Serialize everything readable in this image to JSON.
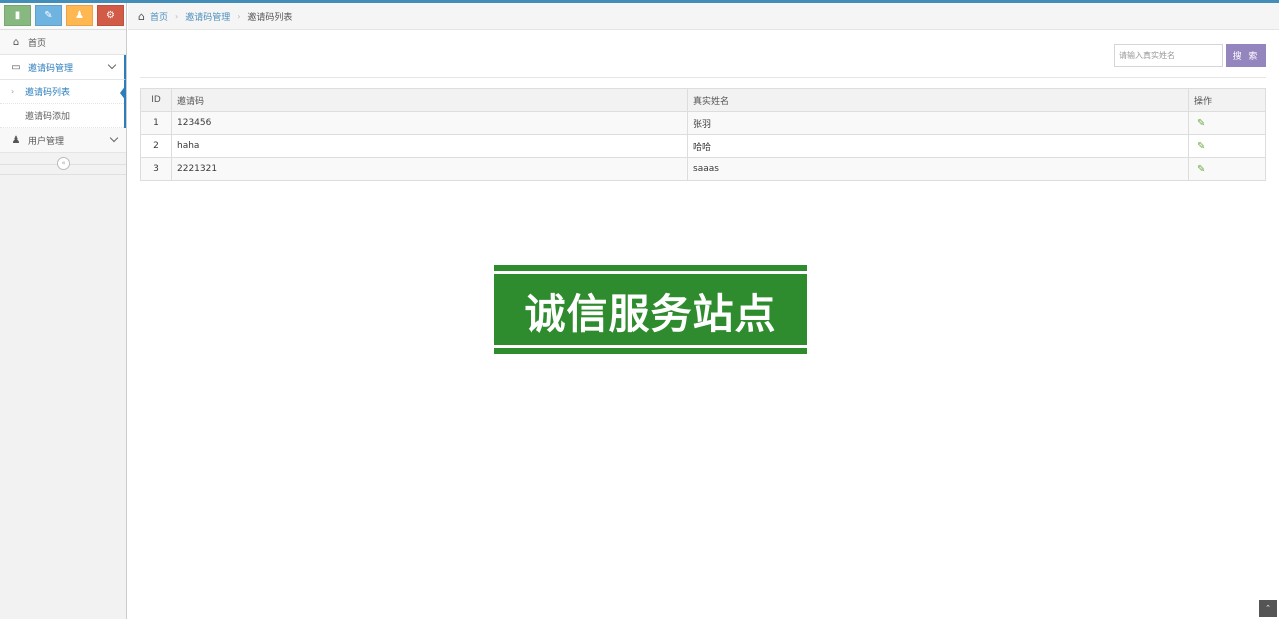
{
  "colors": {
    "accent": "#438eb9",
    "shortcut_1": "#87b87f",
    "shortcut_2": "#6fb3e0",
    "shortcut_3": "#ffb752",
    "shortcut_4": "#d15b47",
    "search_button": "#9585bf",
    "stamp": "#2e8b2e"
  },
  "shortcuts": [
    "signal-icon",
    "pencil-icon",
    "users-icon",
    "cogs-icon"
  ],
  "sidebar": {
    "home": "首页",
    "invite_mgmt": "邀请码管理",
    "invite_list": "邀请码列表",
    "invite_add": "邀请码添加",
    "user_mgmt": "用户管理"
  },
  "breadcrumbs": {
    "home": "首页",
    "section": "邀请码管理",
    "current": "邀请码列表"
  },
  "search": {
    "placeholder": "请输入真实姓名",
    "button": "搜 索"
  },
  "table": {
    "headers": {
      "id": "ID",
      "code": "邀请码",
      "name": "真实姓名",
      "action": "操作"
    },
    "rows": [
      {
        "id": "1",
        "code": "123456",
        "name": "张羽"
      },
      {
        "id": "2",
        "code": "haha",
        "name": "哈哈"
      },
      {
        "id": "3",
        "code": "2221321",
        "name": "saaas"
      }
    ]
  },
  "stamp": "诚信服务站点"
}
